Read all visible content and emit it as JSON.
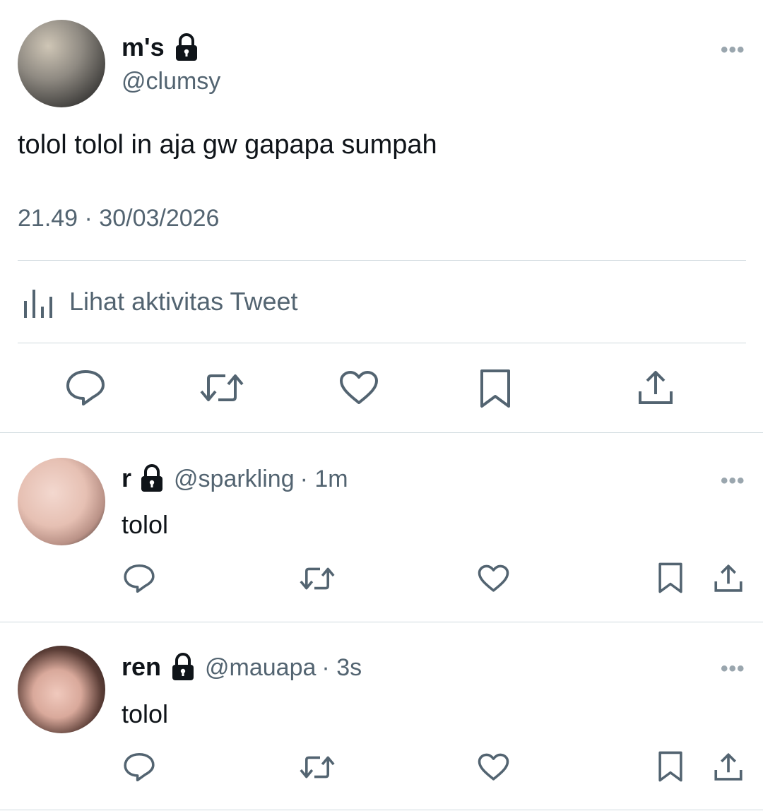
{
  "main_tweet": {
    "display_name": "m's",
    "handle": "@clumsy",
    "text": "tolol tolol in aja gw gapapa sumpah",
    "timestamp": "21.49 · 30/03/2026",
    "activity_label": "Lihat aktivitas Tweet",
    "more_label": "•••"
  },
  "replies": [
    {
      "display_name": "r",
      "handle": "@sparkling",
      "time": "· 1m",
      "text": "tolol",
      "more_label": "•••"
    },
    {
      "display_name": "ren",
      "handle": "@mauapa",
      "time": "· 3s",
      "text": "tolol",
      "more_label": "•••"
    }
  ],
  "icons": {
    "reply": "reply-icon",
    "retweet": "retweet-icon",
    "like": "like-icon",
    "bookmark": "bookmark-icon",
    "share": "share-icon",
    "lock": "lock-icon",
    "analytics": "analytics-icon"
  },
  "colors": {
    "text": "#0f1419",
    "secondary": "#536471",
    "divider": "#cfd9de"
  }
}
